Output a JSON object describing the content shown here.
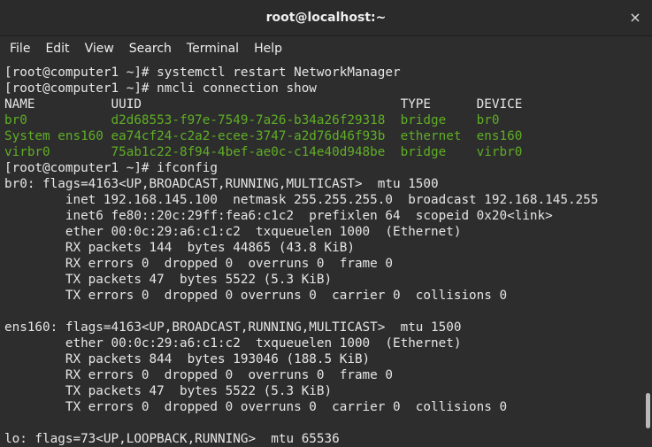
{
  "window": {
    "title": "root@localhost:~",
    "close_label": "×"
  },
  "menu": {
    "items": [
      "File",
      "Edit",
      "View",
      "Search",
      "Terminal",
      "Help"
    ]
  },
  "terminal": {
    "text_color": "#e6e6e6",
    "highlight_color": "#5fae26",
    "lines": [
      {
        "text": "[root@computer1 ~]# systemctl restart NetworkManager",
        "style": "normal"
      },
      {
        "text": "[root@computer1 ~]# nmcli connection show",
        "style": "normal"
      },
      {
        "text": "NAME          UUID                                  TYPE      DEVICE",
        "style": "normal"
      },
      {
        "text": "br0           d2d68553-f97e-7549-7a26-b34a26f29318  bridge    br0",
        "style": "green"
      },
      {
        "text": "System ens160 ea74cf24-c2a2-ecee-3747-a2d76d46f93b  ethernet  ens160",
        "style": "green"
      },
      {
        "text": "virbr0        75ab1c22-8f94-4bef-ae0c-c14e40d948be  bridge    virbr0",
        "style": "green"
      },
      {
        "text": "[root@computer1 ~]# ifconfig",
        "style": "normal"
      },
      {
        "text": "br0: flags=4163<UP,BROADCAST,RUNNING,MULTICAST>  mtu 1500",
        "style": "normal"
      },
      {
        "text": "        inet 192.168.145.100  netmask 255.255.255.0  broadcast 192.168.145.255",
        "style": "normal"
      },
      {
        "text": "        inet6 fe80::20c:29ff:fea6:c1c2  prefixlen 64  scopeid 0x20<link>",
        "style": "normal"
      },
      {
        "text": "        ether 00:0c:29:a6:c1:c2  txqueuelen 1000  (Ethernet)",
        "style": "normal"
      },
      {
        "text": "        RX packets 144  bytes 44865 (43.8 KiB)",
        "style": "normal"
      },
      {
        "text": "        RX errors 0  dropped 0  overruns 0  frame 0",
        "style": "normal"
      },
      {
        "text": "        TX packets 47  bytes 5522 (5.3 KiB)",
        "style": "normal"
      },
      {
        "text": "        TX errors 0  dropped 0 overruns 0  carrier 0  collisions 0",
        "style": "normal"
      },
      {
        "text": "",
        "style": "normal"
      },
      {
        "text": "ens160: flags=4163<UP,BROADCAST,RUNNING,MULTICAST>  mtu 1500",
        "style": "normal"
      },
      {
        "text": "        ether 00:0c:29:a6:c1:c2  txqueuelen 1000  (Ethernet)",
        "style": "normal"
      },
      {
        "text": "        RX packets 844  bytes 193046 (188.5 KiB)",
        "style": "normal"
      },
      {
        "text": "        RX errors 0  dropped 0  overruns 0  frame 0",
        "style": "normal"
      },
      {
        "text": "        TX packets 47  bytes 5522 (5.3 KiB)",
        "style": "normal"
      },
      {
        "text": "        TX errors 0  dropped 0 overruns 0  carrier 0  collisions 0",
        "style": "normal"
      },
      {
        "text": "",
        "style": "normal"
      },
      {
        "text": "lo: flags=73<UP,LOOPBACK,RUNNING>  mtu 65536",
        "style": "normal"
      }
    ]
  }
}
